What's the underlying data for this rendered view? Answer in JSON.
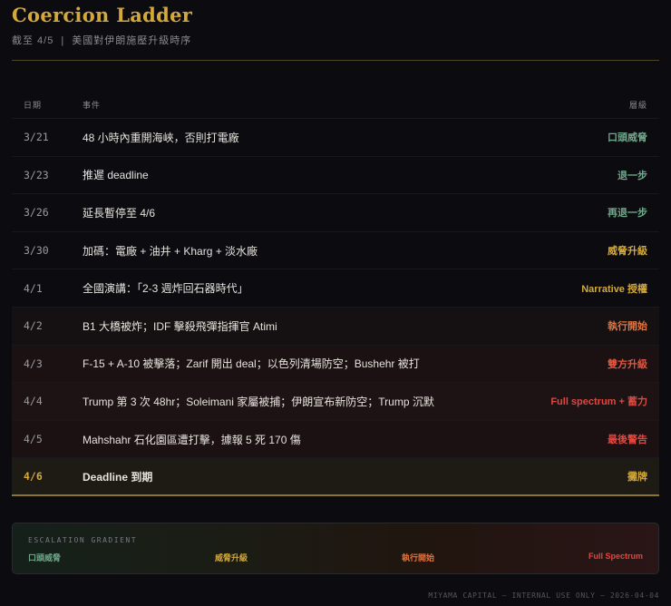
{
  "header": {
    "title": "Coercion Ladder",
    "as_of": "截至 4/5",
    "separator": "|",
    "subtitle": "美國對伊朗施壓升級時序"
  },
  "table": {
    "columns": [
      "日期",
      "事件",
      "層級"
    ],
    "rows": [
      {
        "date": "3/21",
        "event": "48 小時內重開海峽，否則打電廠",
        "level": "口頭威脅",
        "color": "#6fa88a",
        "bg": ""
      },
      {
        "date": "3/23",
        "event": "推遲 deadline",
        "level": "退一步",
        "color": "#6fa88a",
        "bg": ""
      },
      {
        "date": "3/26",
        "event": "延長暫停至 4/6",
        "level": "再退一步",
        "color": "#6fa88a",
        "bg": ""
      },
      {
        "date": "3/30",
        "event": "加碼：電廠 + 油井 + Kharg + 淡水廠",
        "level": "威脅升級",
        "color": "#d4a93a",
        "bg": ""
      },
      {
        "date": "4/1",
        "event": "全國演講：「2-3 週炸回石器時代」",
        "level": "Narrative 授權",
        "color": "#d4a93a",
        "bg": ""
      },
      {
        "date": "4/2",
        "event": "B1 大橋被炸；IDF 擊殺飛彈指揮官 Atimi",
        "level": "執行開始",
        "color": "#e0743f",
        "bg": "#151011"
      },
      {
        "date": "4/3",
        "event": "F-15 + A-10 被擊落；Zarif 開出 deal；以色列清場防空；Bushehr 被打",
        "level": "雙方升級",
        "color": "#e0563f",
        "bg": "#1b1113"
      },
      {
        "date": "4/4",
        "event": "Trump 第 3 次 48hr；Soleimani 家屬被捕；伊朗宣布新防空；Trump 沉默",
        "level": "Full spectrum + 蓄力",
        "color": "#e0483f",
        "bg": "#1d1214"
      },
      {
        "date": "4/5",
        "event": "Mahshahr 石化園區遭打擊，據報 5 死 170 傷",
        "level": "最後警告",
        "color": "#e0483f",
        "bg": "#1b1113"
      },
      {
        "date": "4/6",
        "event": "Deadline 到期",
        "level": "攤牌",
        "color": "#d4a93a",
        "bg": ""
      }
    ]
  },
  "gradient": {
    "label": "ESCALATION GRADIENT",
    "stops": [
      {
        "text": "口頭威脅",
        "color": "#6fa88a"
      },
      {
        "text": "威脅升級",
        "color": "#d4a93a"
      },
      {
        "text": "執行開始",
        "color": "#e0743f"
      },
      {
        "text": "Full Spectrum",
        "color": "#e0483f"
      }
    ]
  },
  "footer": "MIYAMA CAPITAL — INTERNAL USE ONLY — 2026-04-04"
}
